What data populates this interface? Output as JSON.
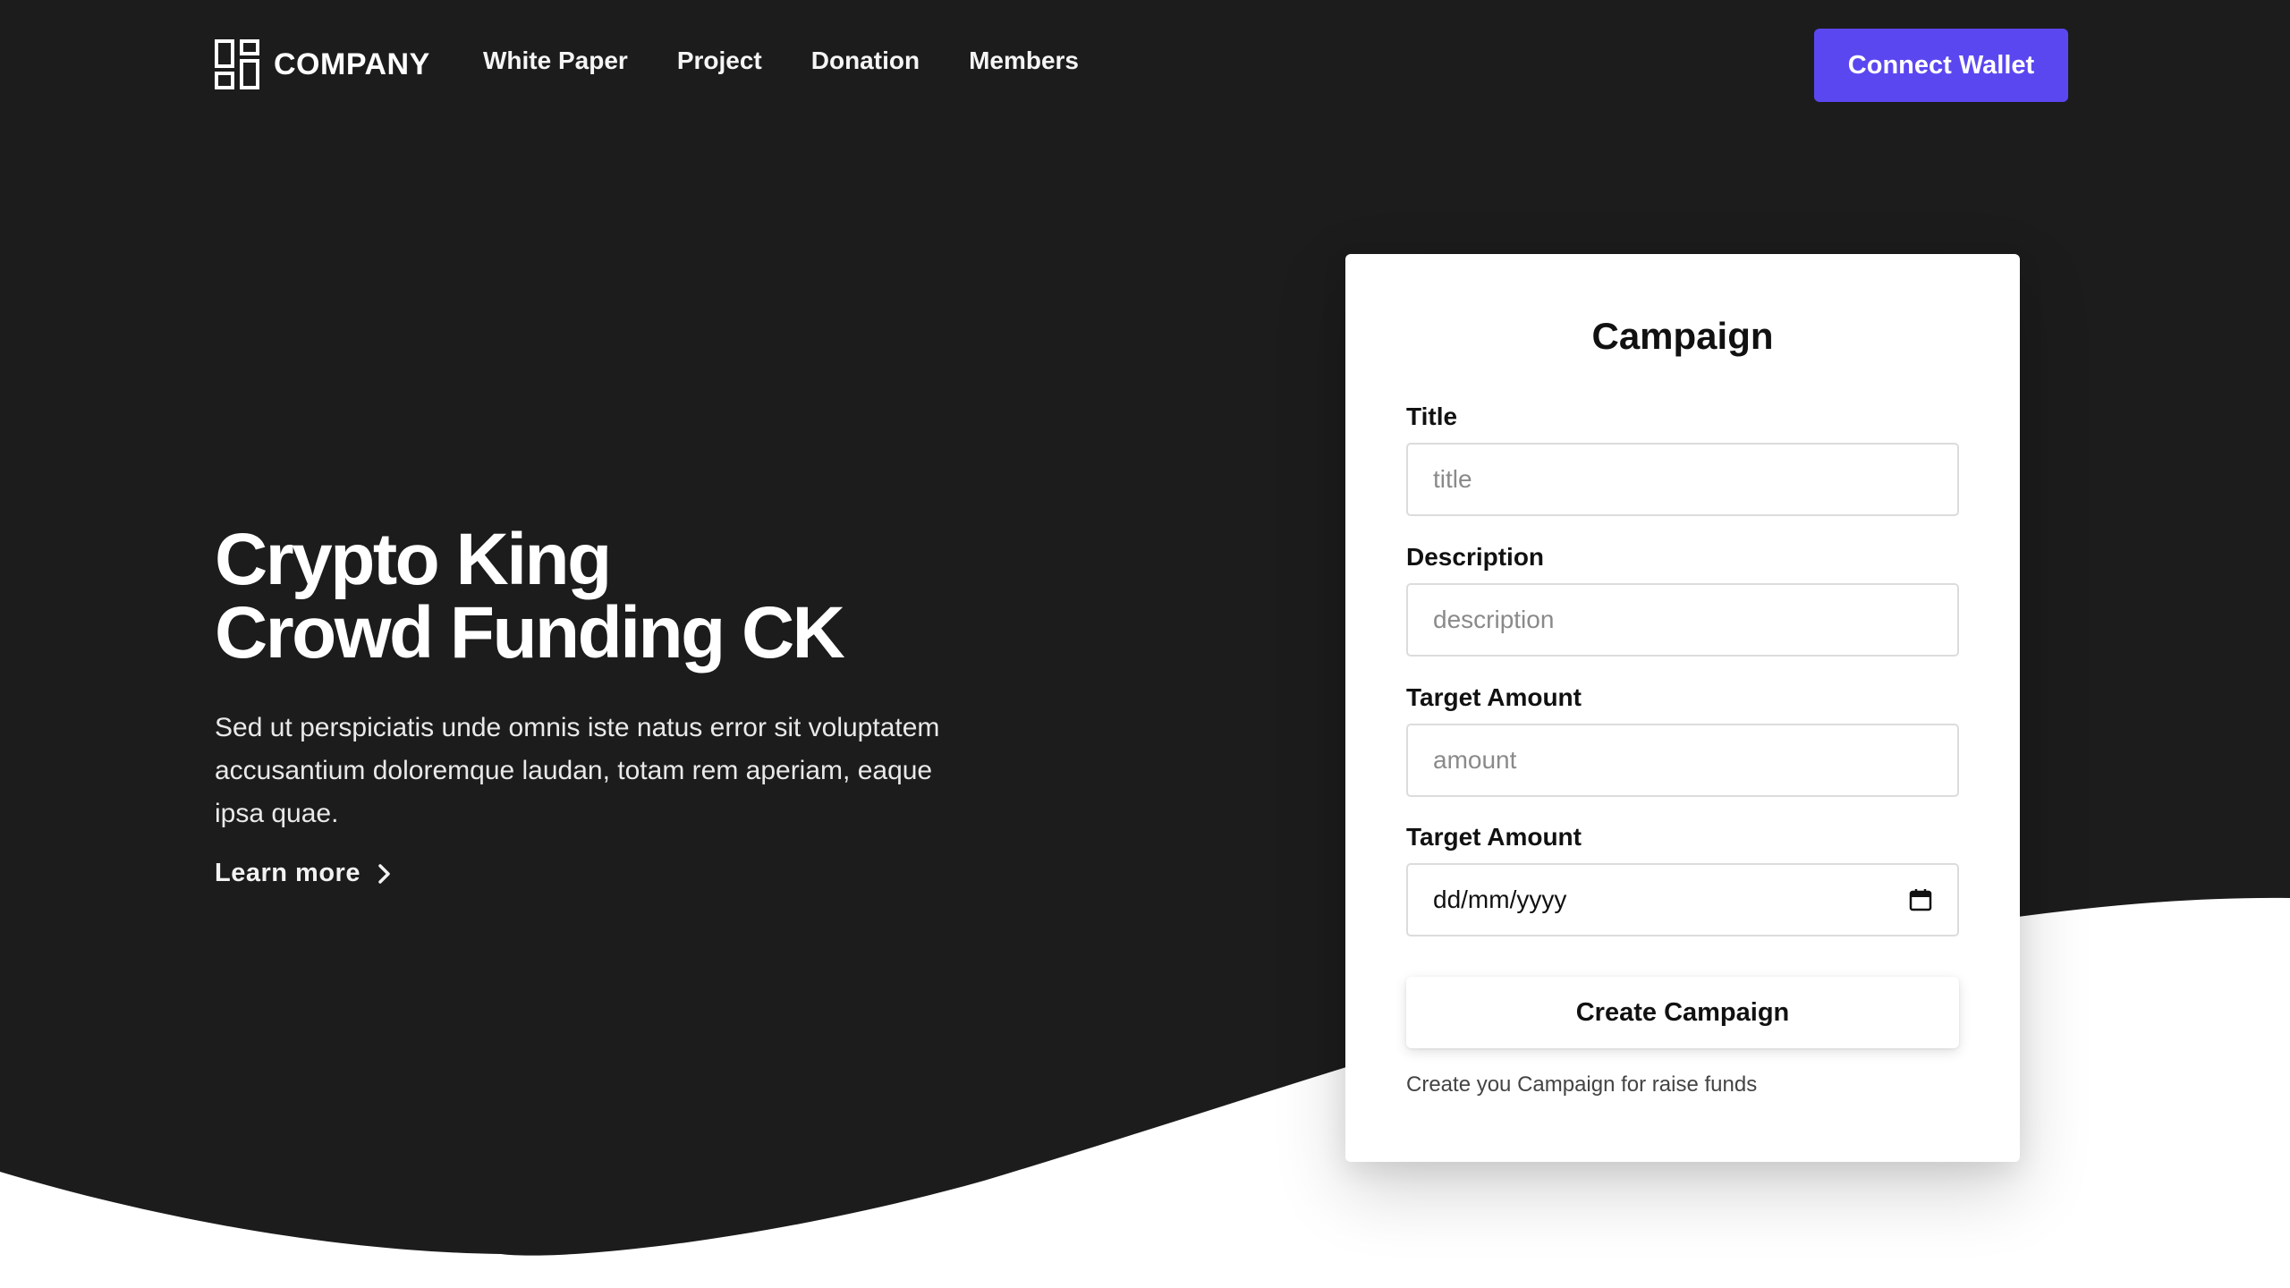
{
  "colors": {
    "hero_background": "#1c1c1c",
    "page_background": "#ffffff",
    "accent": "#5b47f0",
    "card_background": "#ffffff"
  },
  "nav": {
    "brand": "COMPANY",
    "brand_icon": "grid-logo-icon",
    "links": [
      {
        "label": "White Paper"
      },
      {
        "label": "Project"
      },
      {
        "label": "Donation"
      },
      {
        "label": "Members"
      }
    ],
    "cta_label": "Connect Wallet"
  },
  "hero": {
    "title_line1": "Crypto King",
    "title_line2": "Crowd Funding CK",
    "description": "Sed ut perspiciatis unde omnis iste natus error sit voluptatem accusantium doloremque laudan, totam rem aperiam, eaque ipsa quae.",
    "learn_more": "Learn more",
    "learn_more_icon": "chevron-right-icon"
  },
  "campaign_form": {
    "heading": "Campaign",
    "title_label": "Title",
    "title_placeholder": "title",
    "description_label": "Description",
    "description_placeholder": "description",
    "amount_label": "Target Amount",
    "amount_placeholder": "amount",
    "date_label": "Target Amount",
    "date_value": "dd/mm/yyyy",
    "date_icon": "calendar-icon",
    "submit_label": "Create Campaign",
    "note": "Create you Campaign for raise funds"
  }
}
